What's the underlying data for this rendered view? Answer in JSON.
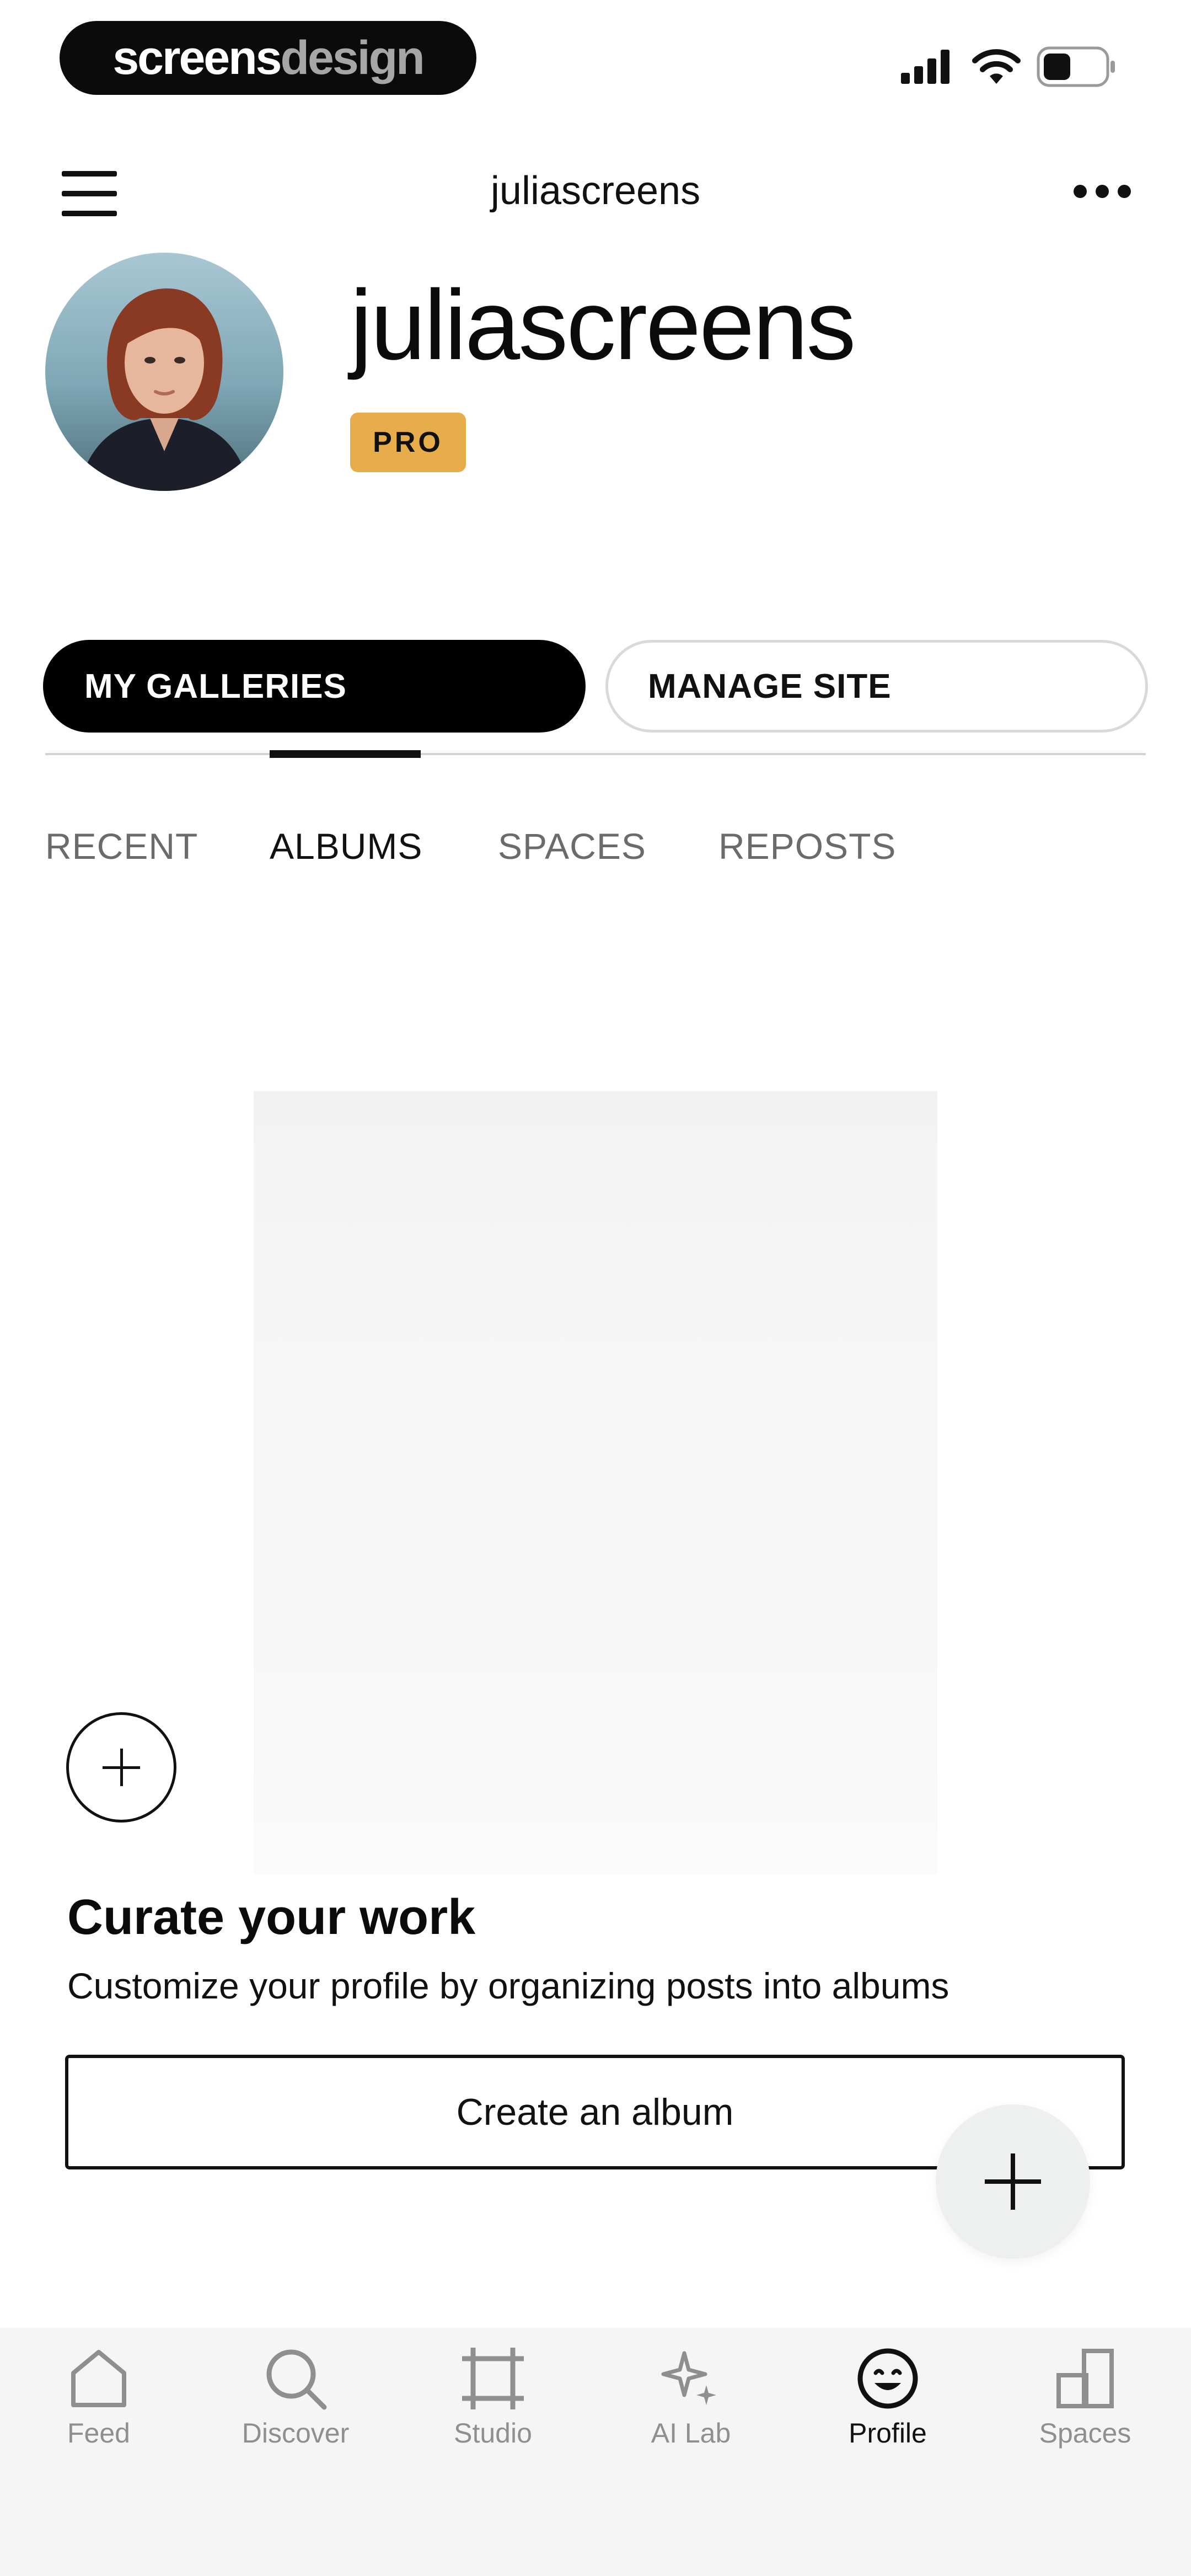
{
  "status_bar": {
    "brand": {
      "part1": "screens",
      "part2": "design"
    },
    "icons": [
      "signal-icon",
      "wifi-icon",
      "battery-icon"
    ]
  },
  "top_nav": {
    "title": "juliascreens",
    "menu_icon": "hamburger-icon",
    "more_icon": "more-dots-icon"
  },
  "profile": {
    "username": "juliascreens",
    "badge": "PRO"
  },
  "actions": {
    "primary": "MY GALLERIES",
    "secondary": "MANAGE SITE"
  },
  "tabs": [
    {
      "label": "RECENT",
      "active": false
    },
    {
      "label": "ALBUMS",
      "active": true
    },
    {
      "label": "SPACES",
      "active": false
    },
    {
      "label": "REPOSTS",
      "active": false
    }
  ],
  "empty_state": {
    "title": "Curate your work",
    "description": "Customize your profile by organizing posts into albums",
    "button": "Create an album"
  },
  "bottom_nav": [
    {
      "label": "Feed",
      "icon": "home-icon",
      "active": false
    },
    {
      "label": "Discover",
      "icon": "search-icon",
      "active": false
    },
    {
      "label": "Studio",
      "icon": "crop-icon",
      "active": false
    },
    {
      "label": "AI Lab",
      "icon": "sparkle-icon",
      "active": false
    },
    {
      "label": "Profile",
      "icon": "smiley-icon",
      "active": true
    },
    {
      "label": "Spaces",
      "icon": "spaces-icon",
      "active": false
    }
  ],
  "colors": {
    "badge": "#e6ad4a",
    "active_button": "#000000",
    "inactive_text": "#8f8f8f",
    "bottom_bar": "#f5f5f5"
  }
}
